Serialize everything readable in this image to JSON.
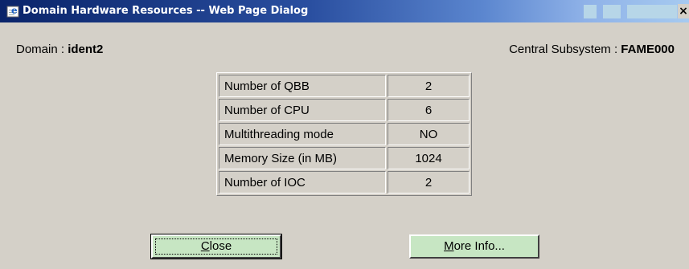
{
  "window": {
    "title": "Domain Hardware Resources -- Web Page Dialog",
    "close_glyph": "×"
  },
  "header": {
    "domain_label": "Domain : ",
    "domain_value": "ident2",
    "subsystem_label": "Central Subsystem : ",
    "subsystem_value": "FAME000"
  },
  "resources": [
    {
      "label": "Number of QBB",
      "value": "2"
    },
    {
      "label": "Number of CPU",
      "value": "6"
    },
    {
      "label": "Multithreading mode",
      "value": "NO"
    },
    {
      "label": "Memory Size (in MB)",
      "value": "1024"
    },
    {
      "label": "Number of IOC",
      "value": "2"
    }
  ],
  "buttons": {
    "close": {
      "mnemonic": "C",
      "rest": "lose"
    },
    "more_info": {
      "mnemonic": "M",
      "rest": "ore Info..."
    }
  },
  "colors": {
    "dialog_bg": "#d4d0c8",
    "titlebar_start": "#0a246a",
    "button_bg": "#c7e6c3"
  },
  "icons": {
    "title": "ie-dialog-icon"
  }
}
